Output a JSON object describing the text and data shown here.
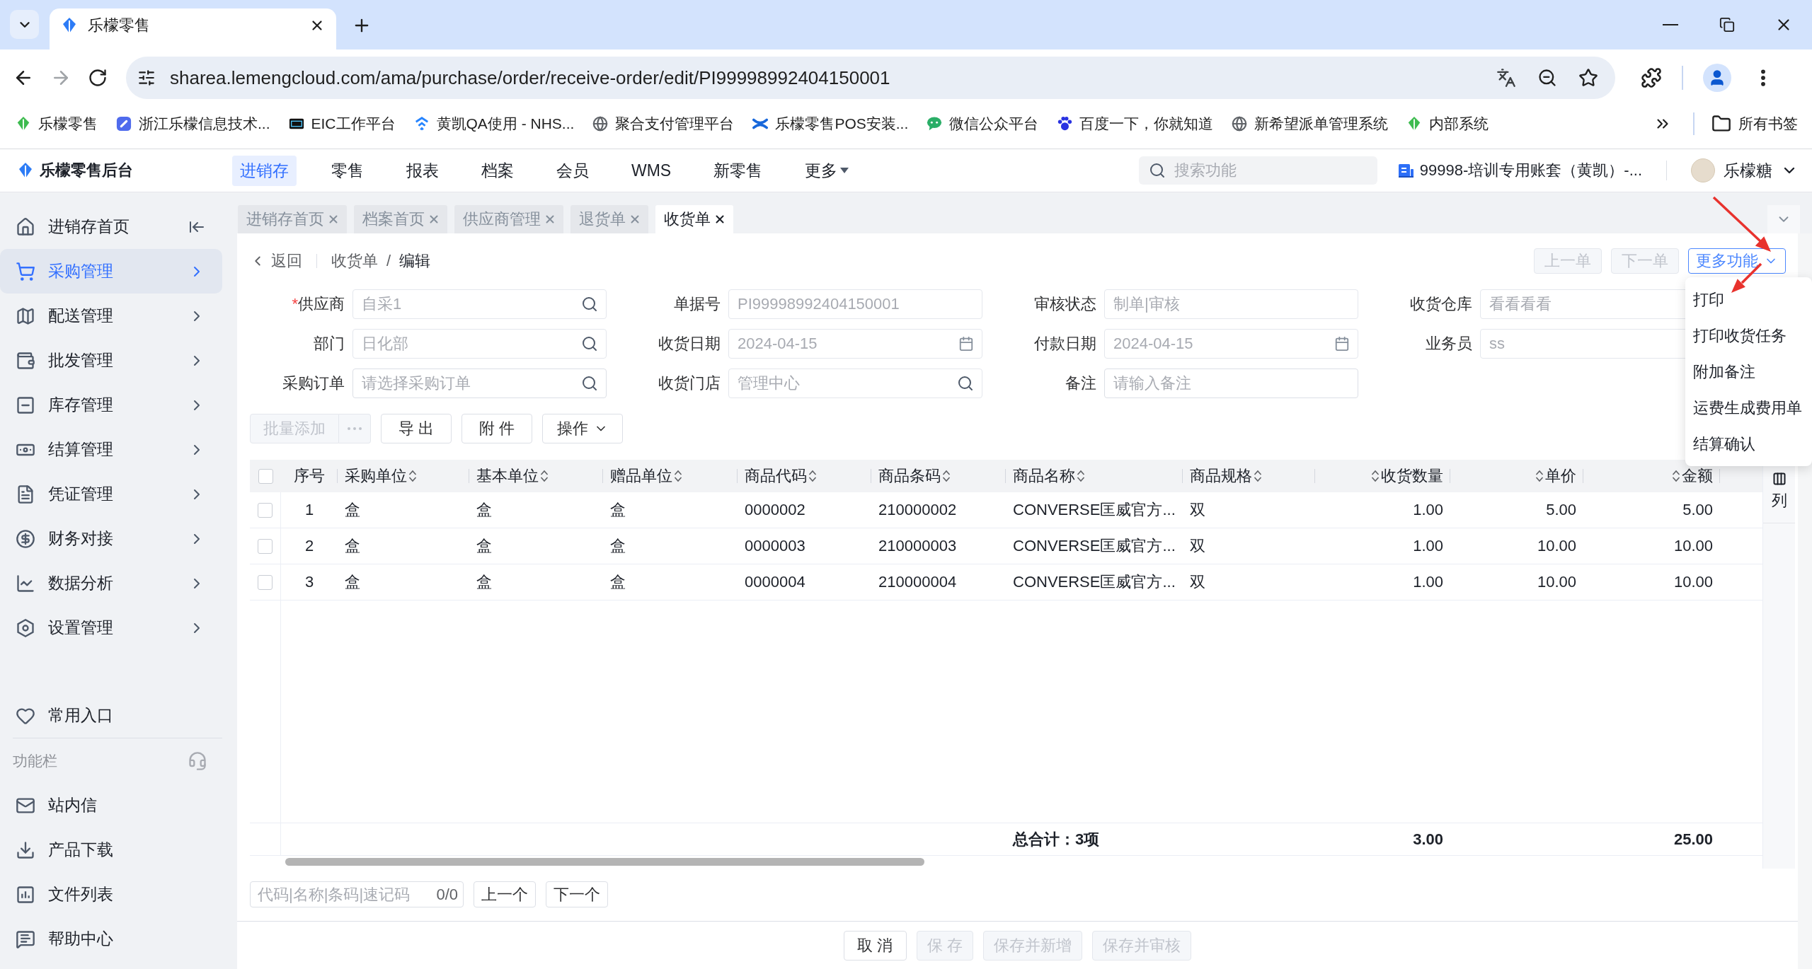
{
  "browser": {
    "tabs": [
      {
        "title": "乐檬零售",
        "selected": true
      }
    ],
    "url": "sharea.lemengcloud.com/ama/purchase/order/receive-order/edit/PI99998992404150001",
    "bookmarks": [
      {
        "label": "乐檬零售"
      },
      {
        "label": "浙江乐檬信息技术..."
      },
      {
        "label": "EIC工作平台"
      },
      {
        "label": "黄凯QA使用 - NHS..."
      },
      {
        "label": "聚合支付管理平台"
      },
      {
        "label": "乐檬零售POS安装..."
      },
      {
        "label": "微信公众平台"
      },
      {
        "label": "百度一下，你就知道"
      },
      {
        "label": "新希望派单管理系统"
      },
      {
        "label": "内部系统"
      }
    ],
    "all_bookmarks": "所有书签"
  },
  "header": {
    "title": "乐檬零售后台",
    "nav": [
      {
        "label": "进销存",
        "selected": true,
        "kind": "link"
      },
      {
        "label": "零售",
        "selected": false,
        "kind": "link"
      },
      {
        "label": "报表",
        "selected": false,
        "kind": "link"
      },
      {
        "label": "档案",
        "selected": false,
        "kind": "link"
      },
      {
        "label": "会员",
        "selected": false,
        "kind": "link"
      },
      {
        "label": "WMS",
        "selected": false,
        "kind": "link"
      },
      {
        "label": "新零售",
        "selected": false,
        "kind": "link"
      },
      {
        "label": "更多",
        "selected": false,
        "kind": "dropdown"
      }
    ],
    "search": {
      "placeholder": "搜索功能"
    },
    "account": "99998-培训专用账套（黄凯）-...",
    "user": "乐檬糖"
  },
  "sidebar": {
    "items": [
      {
        "label": "进销存首页",
        "selected": false,
        "kind": "home"
      },
      {
        "label": "采购管理",
        "selected": true,
        "kind": "group"
      },
      {
        "label": "配送管理",
        "selected": false,
        "kind": "group"
      },
      {
        "label": "批发管理",
        "selected": false,
        "kind": "group"
      },
      {
        "label": "库存管理",
        "selected": false,
        "kind": "group"
      },
      {
        "label": "结算管理",
        "selected": false,
        "kind": "group"
      },
      {
        "label": "凭证管理",
        "selected": false,
        "kind": "group"
      },
      {
        "label": "财务对接",
        "selected": false,
        "kind": "group"
      },
      {
        "label": "数据分析",
        "selected": false,
        "kind": "group"
      },
      {
        "label": "设置管理",
        "selected": false,
        "kind": "group"
      }
    ],
    "favorites": "常用入口",
    "section": "功能栏",
    "tools": [
      {
        "label": "站内信"
      },
      {
        "label": "产品下载"
      },
      {
        "label": "文件列表"
      },
      {
        "label": "帮助中心"
      }
    ]
  },
  "page_tabs": [
    {
      "label": "进销存首页",
      "selected": false
    },
    {
      "label": "档案首页",
      "selected": false
    },
    {
      "label": "供应商管理",
      "selected": false
    },
    {
      "label": "退货单",
      "selected": false
    },
    {
      "label": "收货单",
      "selected": true
    }
  ],
  "breadcrumb": {
    "back": "返回",
    "items": [
      "收货单",
      "编辑"
    ],
    "separator": "/"
  },
  "record_nav": [
    {
      "label": "上一单",
      "disabled": true
    },
    {
      "label": "下一单",
      "disabled": true
    }
  ],
  "more": {
    "label": "更多功能",
    "expanded": true,
    "items": [
      "打印",
      "打印收货任务",
      "附加备注",
      "运费生成费用单",
      "结算确认"
    ]
  },
  "form": [
    {
      "label": "供应商",
      "mark": "*",
      "kind": "lookup",
      "value": "自采1",
      "disabled": true
    },
    {
      "label": "单据号",
      "kind": "text",
      "value": "PI99998992404150001",
      "disabled": true
    },
    {
      "label": "审核状态",
      "kind": "text",
      "value": "制单|审核",
      "disabled": true
    },
    {
      "label": "收货仓库",
      "kind": "text",
      "value": "看看看看",
      "disabled": true
    },
    {
      "label": "部门",
      "kind": "lookup",
      "value": "日化部",
      "disabled": true
    },
    {
      "label": "收货日期",
      "kind": "date",
      "value": "2024-04-15",
      "disabled": true
    },
    {
      "label": "付款日期",
      "kind": "date",
      "value": "2024-04-15",
      "disabled": true
    },
    {
      "label": "业务员",
      "kind": "text",
      "value": "ss",
      "disabled": true
    },
    {
      "label": "采购订单",
      "kind": "lookup",
      "placeholder": "请选择采购订单",
      "disabled": false
    },
    {
      "label": "收货门店",
      "kind": "lookup",
      "value": "管理中心",
      "disabled": true
    },
    {
      "label": "备注",
      "kind": "text",
      "placeholder": "请输入备注",
      "disabled": false
    }
  ],
  "toolbar": [
    {
      "label": "批量添加",
      "kind": "split",
      "disabled": true
    },
    {
      "label": "导 出",
      "kind": "button",
      "disabled": false
    },
    {
      "label": "附 件",
      "kind": "button",
      "disabled": false
    },
    {
      "label": "操作",
      "kind": "dropdown",
      "disabled": false
    }
  ],
  "table": {
    "all_selected": false,
    "columns": [
      {
        "label": "序号",
        "kind": "index"
      },
      {
        "label": "采购单位",
        "kind": "text"
      },
      {
        "label": "基本单位",
        "kind": "text"
      },
      {
        "label": "赠品单位",
        "kind": "text"
      },
      {
        "label": "商品代码",
        "kind": "text"
      },
      {
        "label": "商品条码",
        "kind": "text"
      },
      {
        "label": "商品名称",
        "kind": "text"
      },
      {
        "label": "商品规格",
        "kind": "text"
      },
      {
        "label": "收货数量",
        "kind": "number"
      },
      {
        "label": "单价",
        "kind": "number"
      },
      {
        "label": "金额",
        "kind": "number"
      }
    ],
    "rows": [
      {
        "selected": false,
        "cells": [
          "1",
          "盒",
          "盒",
          "盒",
          "0000002",
          "210000002",
          "CONVERSE匡威官方...",
          "双",
          "1.00",
          "5.00",
          "5.00"
        ]
      },
      {
        "selected": false,
        "cells": [
          "2",
          "盒",
          "盒",
          "盒",
          "0000003",
          "210000003",
          "CONVERSE匡威官方...",
          "双",
          "1.00",
          "10.00",
          "10.00"
        ]
      },
      {
        "selected": false,
        "cells": [
          "3",
          "盒",
          "盒",
          "盒",
          "0000004",
          "210000004",
          "CONVERSE匡威官方...",
          "双",
          "1.00",
          "10.00",
          "10.00"
        ]
      }
    ],
    "summary": {
      "label": "总合计：3项",
      "quantity": "3.00",
      "amount": "25.00"
    },
    "settings": "列"
  },
  "finder": {
    "placeholder": "代码|名称|条码|速记码",
    "count": "0/0",
    "prev": "上一个",
    "next": "下一个"
  },
  "footer": [
    {
      "label": "取 消",
      "disabled": false
    },
    {
      "label": "保 存",
      "disabled": true
    },
    {
      "label": "保存并新增",
      "disabled": true
    },
    {
      "label": "保存并审核",
      "disabled": true
    }
  ]
}
